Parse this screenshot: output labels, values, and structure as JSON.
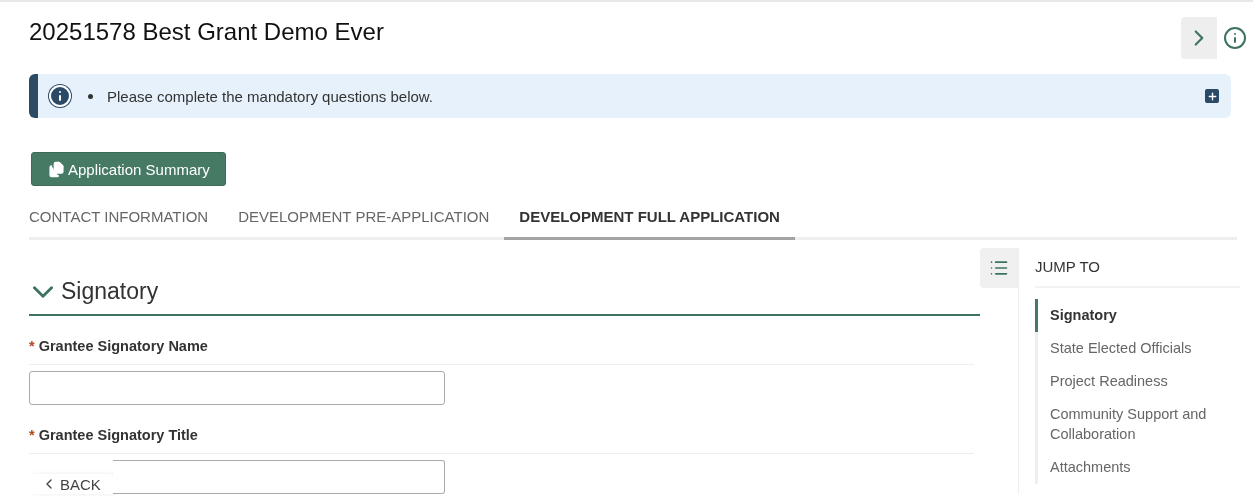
{
  "header": {
    "title": "20251578 Best Grant Demo Ever"
  },
  "alert": {
    "messages": [
      "Please complete the mandatory questions below."
    ],
    "expanded": false
  },
  "summary_button": {
    "label": "Application Summary"
  },
  "tabs": [
    {
      "label": "CONTACT INFORMATION",
      "selected": false
    },
    {
      "label": "DEVELOPMENT PRE-APPLICATION",
      "selected": false
    },
    {
      "label": "DEVELOPMENT FULL APPLICATION",
      "selected": true
    }
  ],
  "section": {
    "title": "Signatory",
    "expanded": true,
    "fields": [
      {
        "label": "Grantee Signatory Name",
        "required_mark": "*"
      },
      {
        "label": "Grantee Signatory Title",
        "required_mark": "*"
      }
    ]
  },
  "jump_to": {
    "title": "JUMP TO",
    "items": [
      {
        "label": "Signatory",
        "selected": true
      },
      {
        "label": "State Elected Officials",
        "selected": false
      },
      {
        "label": "Project Readiness",
        "selected": false
      },
      {
        "label": "Community Support and Collaboration",
        "selected": false
      },
      {
        "label": "Attachments",
        "selected": false
      }
    ]
  },
  "back_button": {
    "label": "BACK"
  }
}
